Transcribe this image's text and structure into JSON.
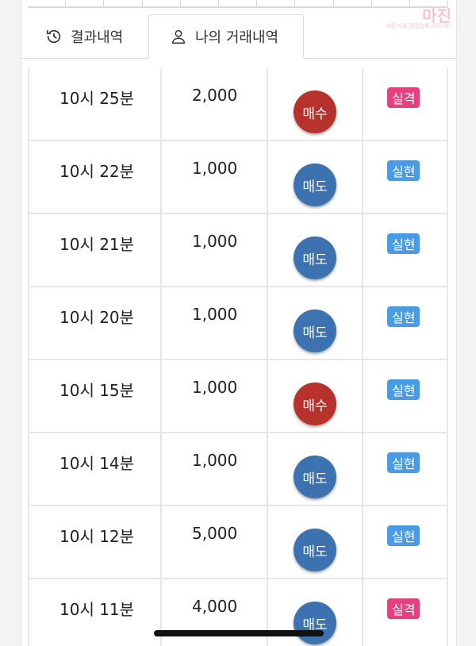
{
  "tabs": {
    "results_label": "결과내역",
    "my_trades_label": "나의 거래내역"
  },
  "watermark": {
    "logo": "마진",
    "sub": "마진거래 검증업체 커뮤니티"
  },
  "colors": {
    "buy": "#b8322d",
    "sell": "#3d72b0",
    "win": "#4a9be6",
    "lose": "#e5407d"
  },
  "rows": [
    {
      "time": "10시 25분",
      "amount": "2,000",
      "direction": "매수",
      "result": "실격"
    },
    {
      "time": "10시 22분",
      "amount": "1,000",
      "direction": "매도",
      "result": "실현"
    },
    {
      "time": "10시 21분",
      "amount": "1,000",
      "direction": "매도",
      "result": "실현"
    },
    {
      "time": "10시 20분",
      "amount": "1,000",
      "direction": "매도",
      "result": "실현"
    },
    {
      "time": "10시 15분",
      "amount": "1,000",
      "direction": "매수",
      "result": "실현"
    },
    {
      "time": "10시 14분",
      "amount": "1,000",
      "direction": "매도",
      "result": "실현"
    },
    {
      "time": "10시 12분",
      "amount": "5,000",
      "direction": "매도",
      "result": "실현"
    },
    {
      "time": "10시 11분",
      "amount": "4,000",
      "direction": "매도",
      "result": "실격"
    }
  ]
}
